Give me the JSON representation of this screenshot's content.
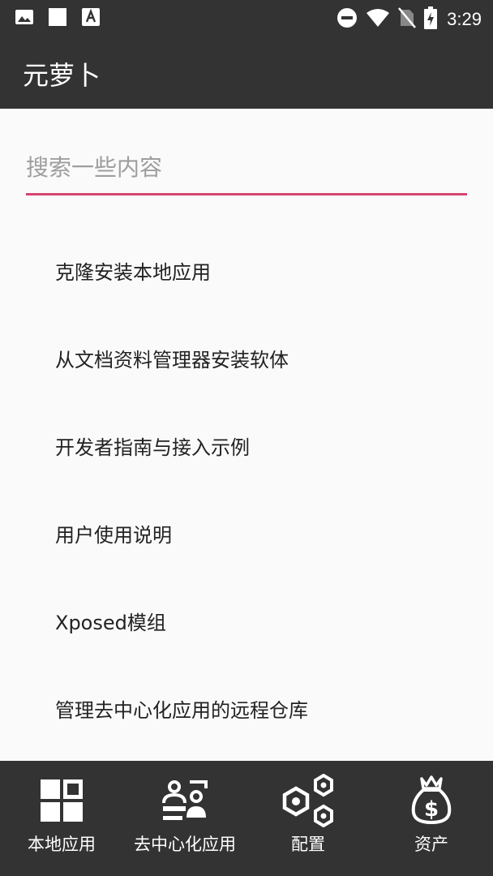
{
  "status_bar": {
    "time": "3:29",
    "left_icons": [
      "image-icon",
      "square-icon",
      "font-icon"
    ],
    "right_icons": [
      "do-not-disturb-icon",
      "wifi-icon",
      "no-sim-icon",
      "battery-charging-icon"
    ]
  },
  "app_bar": {
    "title": "元萝卜"
  },
  "search": {
    "placeholder": "搜索一些内容",
    "value": ""
  },
  "menu": {
    "items": [
      {
        "label": "克隆安装本地应用"
      },
      {
        "label": "从文档资料管理器安装软体"
      },
      {
        "label": "开发者指南与接入示例"
      },
      {
        "label": "用户使用说明"
      },
      {
        "label": "Xposed模组"
      },
      {
        "label": "管理去中心化应用的远程仓库"
      }
    ]
  },
  "bottom_nav": {
    "items": [
      {
        "label": "本地应用",
        "icon": "grid-apps-icon"
      },
      {
        "label": "去中心化应用",
        "icon": "people-icon"
      },
      {
        "label": "配置",
        "icon": "hex-nuts-icon"
      },
      {
        "label": "资产",
        "icon": "money-bag-icon"
      }
    ]
  },
  "colors": {
    "bar_background": "#333333",
    "content_background": "#fafafa",
    "accent_underline": "#d6456f",
    "text_primary": "#222222",
    "placeholder": "#9e9e9e"
  }
}
